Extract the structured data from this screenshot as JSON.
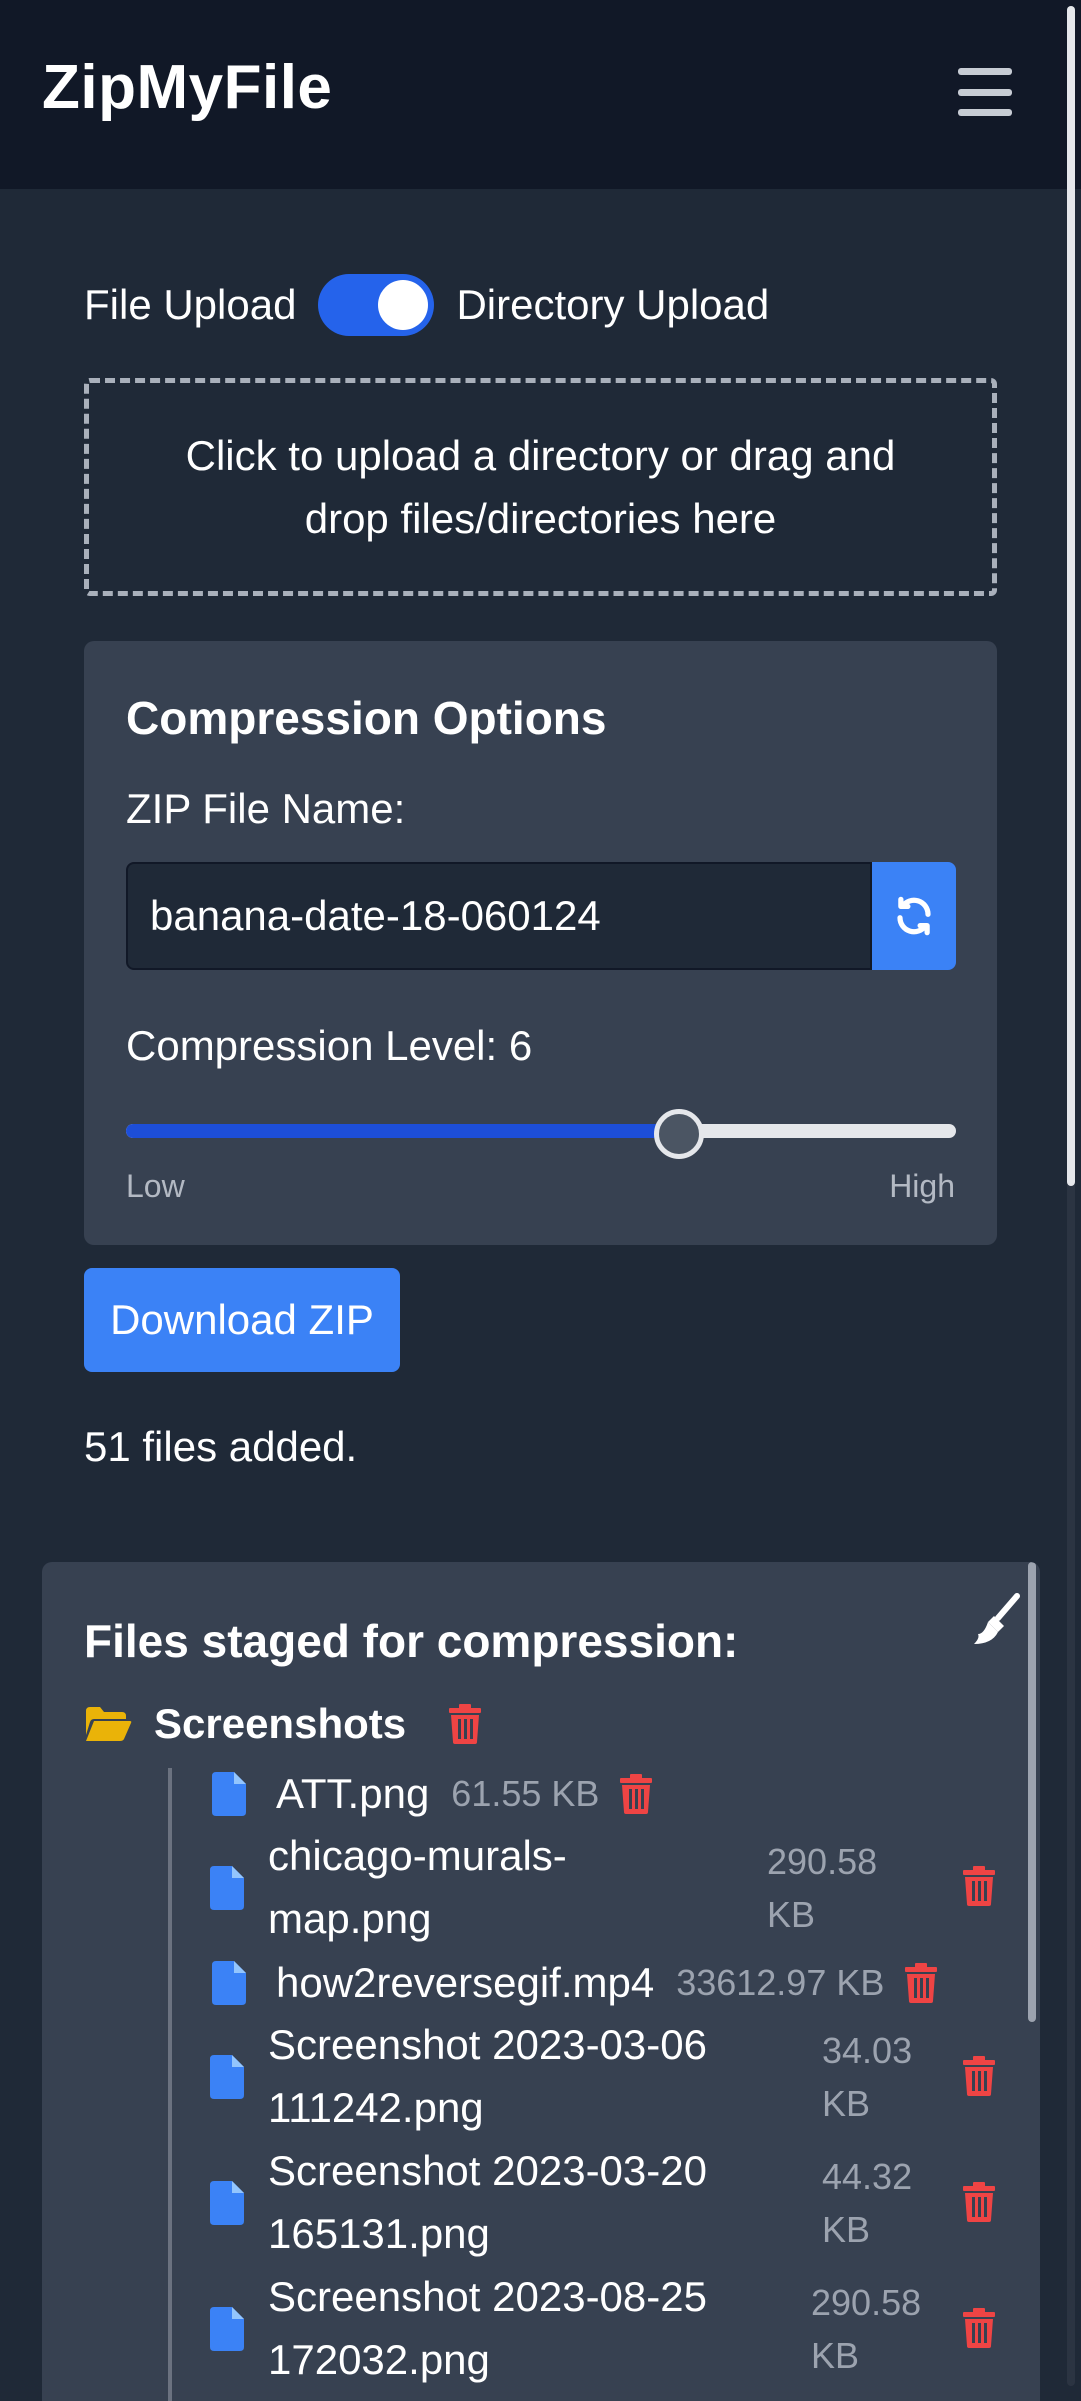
{
  "header": {
    "title": "ZipMyFile",
    "menu_icon": "hamburger-menu-icon"
  },
  "upload": {
    "mode_left_label": "File Upload",
    "mode_right_label": "Directory Upload",
    "directory_mode_on": true,
    "dropzone_text": "Click to upload a directory or drag and drop files/directories here"
  },
  "options": {
    "title": "Compression Options",
    "zip_name_label": "ZIP File Name:",
    "zip_name_value": "banana-date-18-060124",
    "compression_label": "Compression Level: 6",
    "compression_level": 6,
    "compression_min": 0,
    "compression_max": 9,
    "range_low": "Low",
    "range_high": "High"
  },
  "actions": {
    "download_label": "Download ZIP"
  },
  "status": {
    "file_count_text": "51 files added."
  },
  "staged": {
    "title": "Files staged for compression:",
    "folder": {
      "name": "Screenshots"
    },
    "files": [
      {
        "name": "ATT.png",
        "size": "61.55 KB"
      },
      {
        "name_line1": "chicago-murals-",
        "name_line2": "map.png",
        "size_line1": "290.58",
        "size_line2": "KB"
      },
      {
        "name": "how2reversegif.mp4",
        "size": "33612.97 KB"
      },
      {
        "name_line1": "Screenshot 2023-03-06",
        "name_line2": "111242.png",
        "size_line1": "34.03",
        "size_line2": "KB"
      },
      {
        "name_line1": "Screenshot 2023-03-20",
        "name_line2": "165131.png",
        "size_line1": "44.32",
        "size_line2": "KB"
      },
      {
        "name_line1": "Screenshot 2023-08-25",
        "name_line2": "172032.png",
        "size_line1": "290.58",
        "size_line2": "KB"
      }
    ]
  },
  "colors": {
    "background": "#1f2937",
    "topbar": "#111827",
    "panel": "#374151",
    "accent": "#3b82f6",
    "toggle": "#2563eb",
    "danger": "#ef4444",
    "folder": "#eab308"
  }
}
